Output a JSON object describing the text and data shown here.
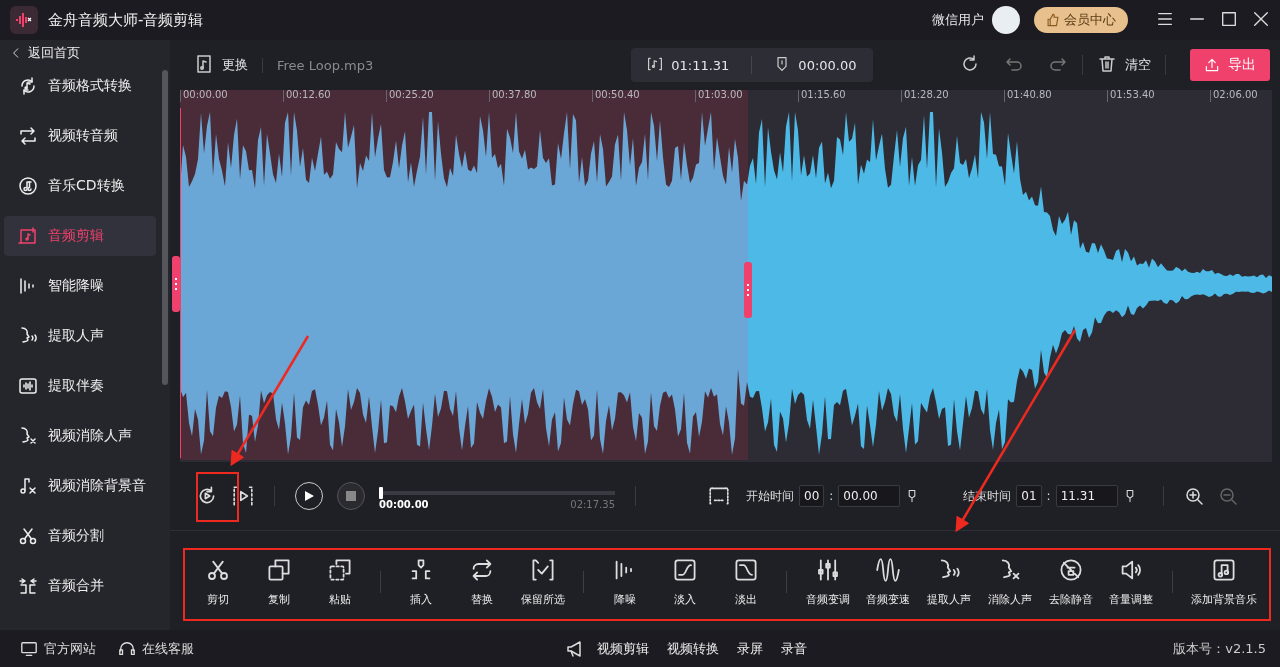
{
  "window": {
    "title": "金舟音频大师-音频剪辑",
    "user": "微信用户",
    "vip_button": "会员中心"
  },
  "sidebar": {
    "back": "返回首页",
    "items": [
      {
        "label": "音频格式转换",
        "selected": false
      },
      {
        "label": "视频转音频",
        "selected": false
      },
      {
        "label": "音乐CD转换",
        "selected": false
      },
      {
        "label": "音频剪辑",
        "selected": true
      },
      {
        "label": "智能降噪",
        "selected": false
      },
      {
        "label": "提取人声",
        "selected": false
      },
      {
        "label": "提取伴奏",
        "selected": false
      },
      {
        "label": "视频消除人声",
        "selected": false
      },
      {
        "label": "视频消除背景音",
        "selected": false
      },
      {
        "label": "音频分割",
        "selected": false
      },
      {
        "label": "音频合并",
        "selected": false
      }
    ]
  },
  "file_bar": {
    "replace": "更换",
    "file_name": "Free Loop.mp3",
    "duration": "01:11.31",
    "position": "00:00.00",
    "clear": "清空",
    "export": "导出"
  },
  "ruler": [
    "00:00.00",
    "00:12.60",
    "00:25.20",
    "00:37.80",
    "00:50.40",
    "01:03.00",
    "01:15.60",
    "01:28.20",
    "01:40.80",
    "01:53.40",
    "02:06.00"
  ],
  "playback": {
    "current": "00:00.00",
    "total": "02:17.35",
    "level": 0.0,
    "separator": [
      ":",
      ":"
    ],
    "start_label": "开始时间",
    "start_min": "00",
    "start_sec": "00.00",
    "end_label": "结束时间",
    "end_min": "01",
    "end_sec": "11.31"
  },
  "tools": [
    [
      "剪切",
      "复制",
      "粘贴"
    ],
    [
      "插入",
      "替换",
      "保留所选"
    ],
    [
      "降噪",
      "淡入",
      "淡出"
    ],
    [
      "音频变调",
      "音频变速",
      "提取人声",
      "消除人声",
      "去除静音",
      "音量调整"
    ],
    [
      "添加背景音乐"
    ]
  ],
  "footer": {
    "links": [
      "官方网站",
      "在线客服"
    ],
    "center": [
      "视频剪辑",
      "视频转换",
      "录屏",
      "录音"
    ],
    "version": "版本号：v2.1.5"
  }
}
